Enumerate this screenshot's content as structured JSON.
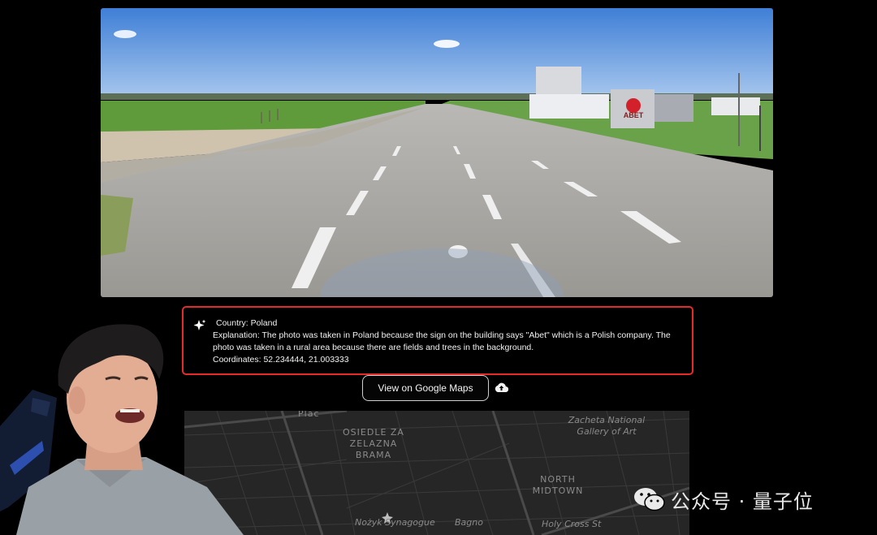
{
  "answer": {
    "country": "Country: Poland",
    "explanation": "Explanation: The photo was taken in Poland because the sign on the building says \"Abet\" which is a Polish company. The photo was taken in a rural area because there are fields and trees in the background.",
    "coordinates": "Coordinates: 52.234444, 21.003333"
  },
  "actions": {
    "view_maps_label": "View on Google Maps",
    "upload_icon": "cloud-upload-icon"
  },
  "photo": {
    "sign_text": "ABET"
  },
  "map": {
    "labels": {
      "osiedle": [
        "OSIEDLE ZA",
        "ZELAZNA",
        "BRAMA"
      ],
      "zacheta": [
        "Zacheta National",
        "Gallery of Art"
      ],
      "north_midtown": [
        "NORTH",
        "MIDTOWN"
      ],
      "nozyk": "Nożyk Synagogue",
      "bagno": "Bagno",
      "holy_cross": "Holy Cross St",
      "plac": "Plac"
    }
  },
  "watermark": {
    "text": "公众号 · 量子位"
  }
}
